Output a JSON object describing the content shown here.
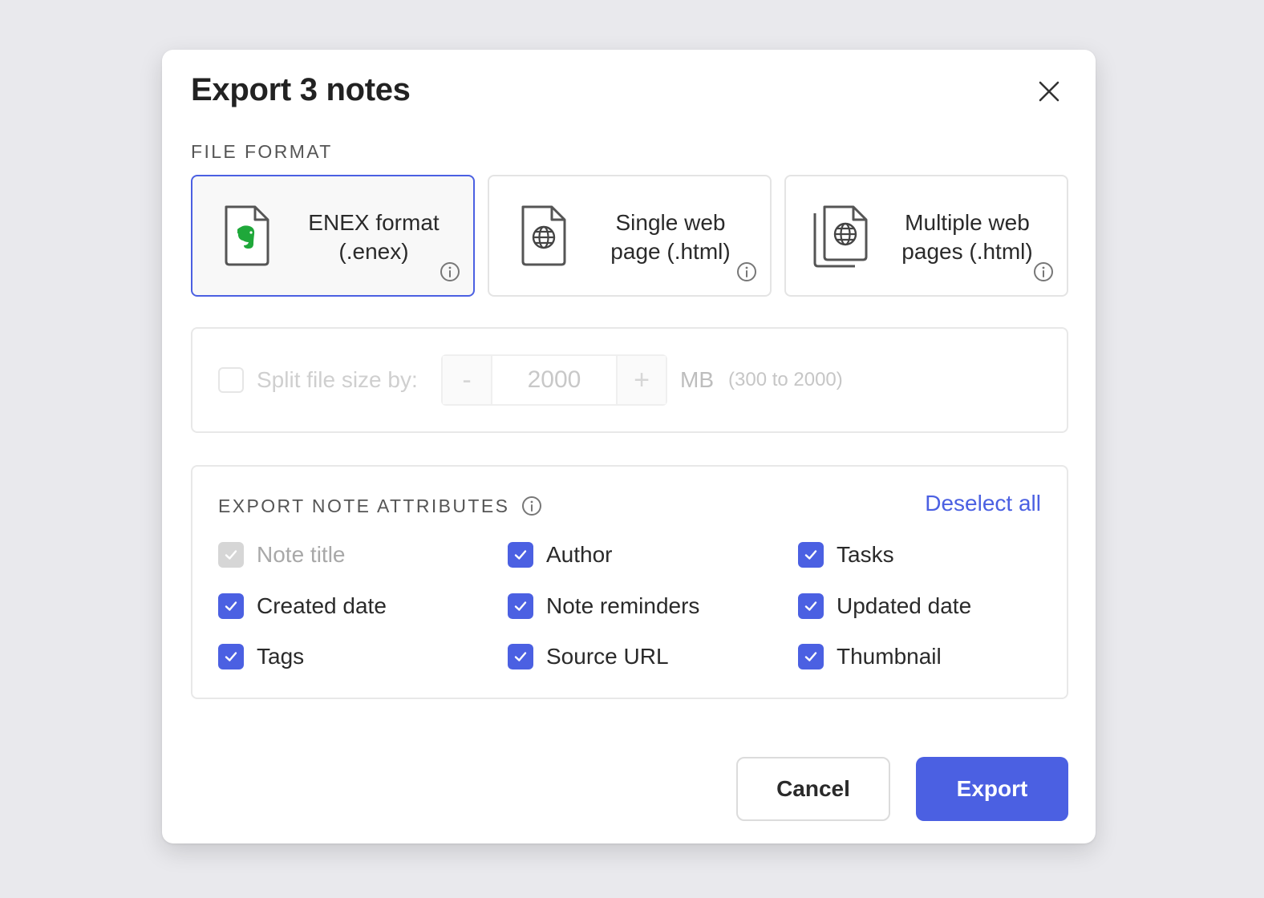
{
  "dialog": {
    "title": "Export 3 notes",
    "close_icon": "close-icon",
    "file_format_label": "FILE FORMAT",
    "formats": [
      {
        "line1": "ENEX format",
        "line2": "(.enex)",
        "icon": "enex-file-icon",
        "selected": true
      },
      {
        "line1": "Single web",
        "line2": "page (.html)",
        "icon": "html-file-icon",
        "selected": false
      },
      {
        "line1": "Multiple web",
        "line2": "pages (.html)",
        "icon": "multiple-html-files-icon",
        "selected": false
      }
    ],
    "split": {
      "label": "Split file size by:",
      "minus": "-",
      "value": "2000",
      "plus": "+",
      "unit": "MB",
      "range": "(300 to 2000)",
      "checked": false,
      "enabled": false
    },
    "attributes": {
      "title": "EXPORT NOTE ATTRIBUTES",
      "deselect_all": "Deselect all",
      "items": [
        {
          "label": "Note title",
          "checked": true,
          "disabled": true
        },
        {
          "label": "Author",
          "checked": true,
          "disabled": false
        },
        {
          "label": "Tasks",
          "checked": true,
          "disabled": false
        },
        {
          "label": "Created date",
          "checked": true,
          "disabled": false
        },
        {
          "label": "Note reminders",
          "checked": true,
          "disabled": false
        },
        {
          "label": "Updated date",
          "checked": true,
          "disabled": false
        },
        {
          "label": "Tags",
          "checked": true,
          "disabled": false
        },
        {
          "label": "Source URL",
          "checked": true,
          "disabled": false
        },
        {
          "label": "Thumbnail",
          "checked": true,
          "disabled": false
        }
      ]
    },
    "buttons": {
      "cancel": "Cancel",
      "export": "Export"
    },
    "colors": {
      "accent": "#4b60e2",
      "evernote_green": "#1fa83a",
      "disabled_checkbox": "#d6d6d6"
    }
  }
}
